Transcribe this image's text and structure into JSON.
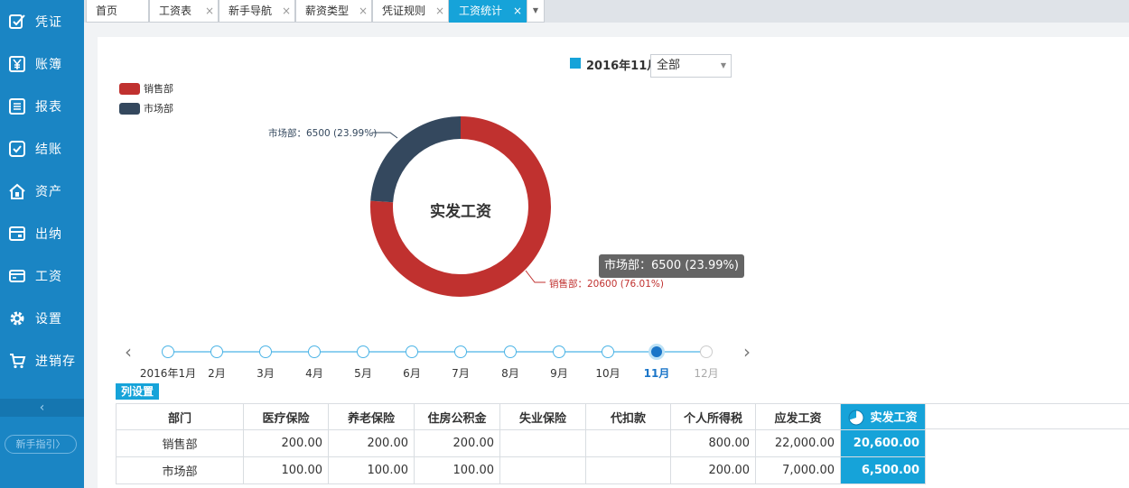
{
  "sidebar": {
    "items": [
      {
        "label": "凭证",
        "icon": "voucher-edit-icon"
      },
      {
        "label": "账簿",
        "icon": "ledger-yen-icon"
      },
      {
        "label": "报表",
        "icon": "report-list-icon"
      },
      {
        "label": "结账",
        "icon": "checkout-check-icon"
      },
      {
        "label": "资产",
        "icon": "asset-house-icon"
      },
      {
        "label": "出纳",
        "icon": "cashier-wallet-icon"
      },
      {
        "label": "工资",
        "icon": "salary-card-icon"
      },
      {
        "label": "设置",
        "icon": "settings-gear-icon"
      },
      {
        "label": "进销存",
        "icon": "inventory-cart-icon"
      }
    ],
    "collapse_glyph": "‹",
    "guide_label": "新手指引〉"
  },
  "tabs": [
    {
      "label": "首页",
      "closable": false
    },
    {
      "label": "工资表",
      "closable": true
    },
    {
      "label": "新手导航",
      "closable": true
    },
    {
      "label": "薪资类型",
      "closable": true
    },
    {
      "label": "凭证规则",
      "closable": true
    },
    {
      "label": "工资统计",
      "closable": true,
      "active": true
    }
  ],
  "tab_close_glyph": "×",
  "filter": {
    "period": "2016年11月",
    "department": "全部"
  },
  "colors": {
    "accent": "#16a3d9",
    "sidebar": "#1a85c4",
    "sales": "#c0312f",
    "market": "#34485e"
  },
  "chart_data": {
    "type": "pie",
    "subtype": "donut",
    "center_label": "实发工资",
    "legend": [
      "销售部",
      "市场部"
    ],
    "slices": [
      {
        "name": "销售部",
        "value": 20600,
        "percent": 76.01,
        "label": "销售部：20600 (76.01%)",
        "color": "#c0312f"
      },
      {
        "name": "市场部",
        "value": 6500,
        "percent": 23.99,
        "label": "市场部：6500 (23.99%)",
        "color": "#34485e"
      }
    ],
    "tooltip": "市场部：6500 (23.99%)"
  },
  "timeline": {
    "months": [
      "2016年1月",
      "2月",
      "3月",
      "4月",
      "5月",
      "6月",
      "7月",
      "8月",
      "9月",
      "10月",
      "11月",
      "12月"
    ],
    "active_index": 10,
    "prev_glyph": "‹",
    "next_glyph": "›"
  },
  "column_settings_label": "列设置",
  "table": {
    "columns": [
      "部门",
      "医疗保险",
      "养老保险",
      "住房公积金",
      "失业保险",
      "代扣款",
      "个人所得税",
      "应发工资",
      "实发工资"
    ],
    "rows": [
      [
        "销售部",
        "200.00",
        "200.00",
        "200.00",
        "",
        "",
        "800.00",
        "22,000.00",
        "20,600.00"
      ],
      [
        "市场部",
        "100.00",
        "100.00",
        "100.00",
        "",
        "",
        "200.00",
        "7,000.00",
        "6,500.00"
      ]
    ]
  }
}
